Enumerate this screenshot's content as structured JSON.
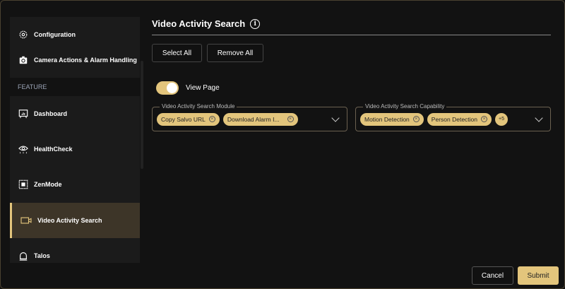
{
  "sidebar": {
    "items": [
      {
        "label": "Configuration",
        "icon": "gear-icon"
      },
      {
        "label": "Camera Actions & Alarm Handling",
        "icon": "camera-flip-icon"
      },
      {
        "label": "Dashboard",
        "icon": "dashboard-icon"
      },
      {
        "label": "HealthCheck",
        "icon": "eye-icon"
      },
      {
        "label": "ZenMode",
        "icon": "grid-icon"
      },
      {
        "label": "Video Activity Search",
        "icon": "video-camera-icon",
        "active": true
      },
      {
        "label": "Talos",
        "icon": "bell-icon"
      }
    ],
    "section_label": "FEATURE"
  },
  "main": {
    "title": "Video Activity Search",
    "select_all": "Select All",
    "remove_all": "Remove All",
    "toggle": {
      "label": "View Page",
      "on": true
    },
    "module": {
      "legend": "Video Activity Search Module",
      "chips": [
        "Copy Salvo URL",
        "Download Alarm I..."
      ]
    },
    "capability": {
      "legend": "Video Activity Search Capability",
      "chips": [
        "Motion Detection",
        "Person Detection"
      ],
      "more": "+5"
    },
    "cancel": "Cancel",
    "submit": "Submit"
  },
  "colors": {
    "accent": "#e3c57c",
    "active_bg": "#3d3528"
  }
}
